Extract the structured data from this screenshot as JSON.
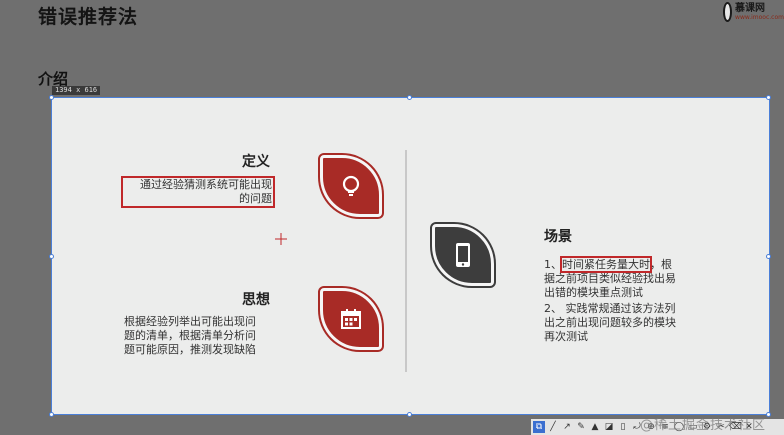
{
  "header": {
    "title": "错误推荐法",
    "logo_text": "慕课网",
    "logo_sub": "www.imooc.com"
  },
  "section": {
    "heading": "介绍"
  },
  "selection": {
    "size_label": "1394 x 616"
  },
  "slide": {
    "definition": {
      "heading": "定义",
      "text_line1": "通过经验猜测系统可能出现",
      "text_line2": "的问题",
      "icon": "lightbulb-icon"
    },
    "idea": {
      "heading": "思想",
      "text_line1": "根据经验列举出可能出现问",
      "text_line2": "题的清单，根据清单分析问",
      "text_line3": "题可能原因，推测发现缺陷",
      "icon": "calendar-icon"
    },
    "scenario": {
      "heading": "场景",
      "item1_prefix": "1、",
      "item1_highlight": "时间紧任务量大时",
      "item1_rest": "，根",
      "item1_line2": "据之前项目类似经验找出易",
      "item1_line3": "出错的模块重点测试",
      "item2_line1": "2、 实践常规通过该方法列",
      "item2_line2": "出之前出现问题较多的模块",
      "item2_line3": "再次测试",
      "icon": "smartphone-icon"
    }
  },
  "toolbar": {
    "tools": [
      "⧉",
      "╱",
      "↗",
      "✎",
      "▲",
      "◪",
      "▯",
      "⤾",
      "⊕",
      "≡",
      "◯",
      "▭",
      "⚙",
      "✂",
      "⌫",
      "✕"
    ]
  },
  "watermark": {
    "text": "@稀土掘金技术社区"
  },
  "colors": {
    "accent_red": "#a82b26",
    "icon_dark": "#3d3d3d",
    "selection_blue": "#4a7fd8",
    "highlight_box": "#c0282a"
  }
}
